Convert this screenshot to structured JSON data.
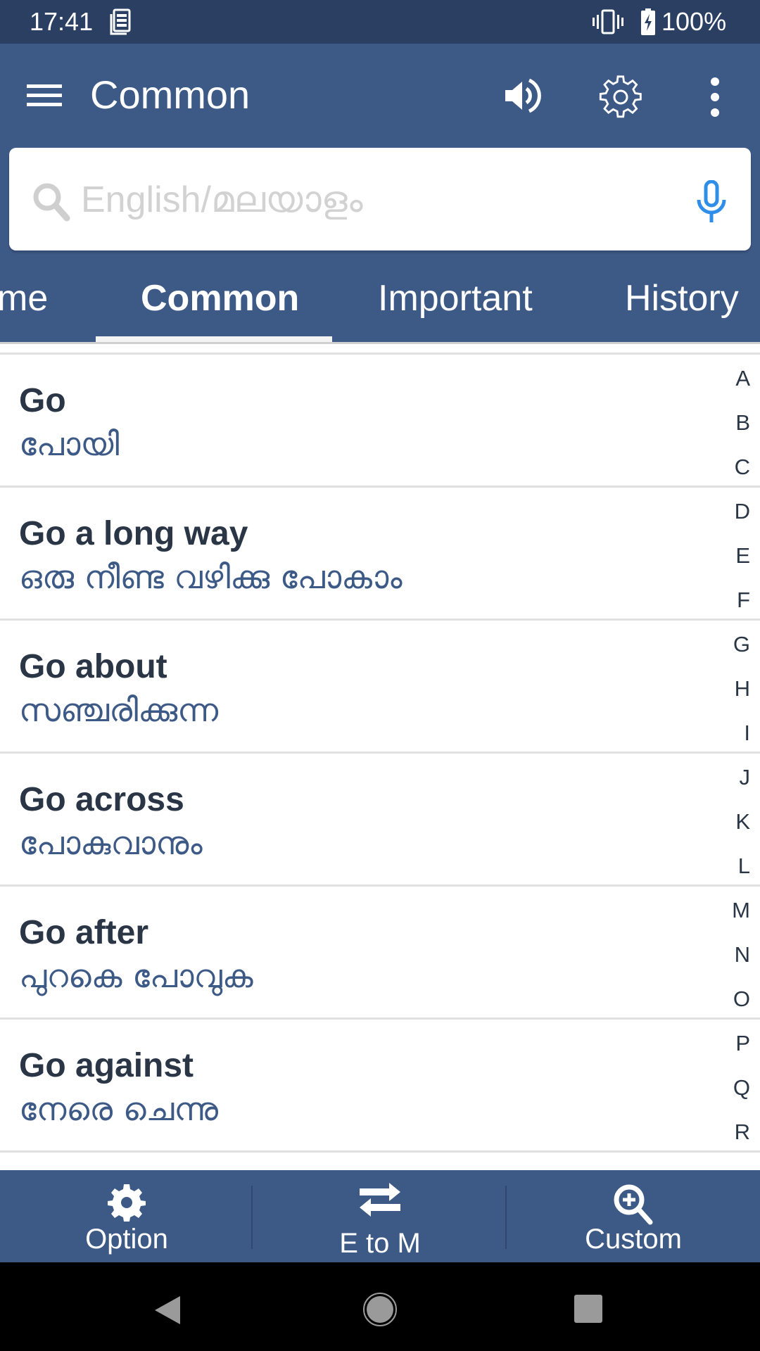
{
  "status_bar": {
    "time": "17:41",
    "battery": "100%",
    "icons": [
      "notification-icon",
      "vibrate-icon",
      "battery-charging-icon"
    ]
  },
  "app_bar": {
    "title": "Common",
    "icons": [
      "menu-icon",
      "speaker-icon",
      "settings-icon",
      "more-vert-icon"
    ]
  },
  "search": {
    "placeholder": "English/മലയാളം",
    "value": "",
    "icons": [
      "search-icon",
      "mic-icon"
    ]
  },
  "tabs": [
    {
      "label": "me",
      "active": false
    },
    {
      "label": "Common",
      "active": true
    },
    {
      "label": "Important",
      "active": false
    },
    {
      "label": "History",
      "active": false
    }
  ],
  "entries": [
    {
      "en": "Go",
      "ml": "പോയി"
    },
    {
      "en": "Go a long way",
      "ml": "ഒരു നീണ്ട വഴിക്കു പോകാം"
    },
    {
      "en": "Go about",
      "ml": "സഞ്ചരിക്കുന്ന"
    },
    {
      "en": "Go across",
      "ml": "പോകുവാനും"
    },
    {
      "en": "Go after",
      "ml": "പുറകെ പോവുക"
    },
    {
      "en": "Go against",
      "ml": "നേരെ ചെന്നു"
    }
  ],
  "alphabet": [
    "A",
    "B",
    "C",
    "D",
    "E",
    "F",
    "G",
    "H",
    "I",
    "J",
    "K",
    "L",
    "M",
    "N",
    "O",
    "P",
    "Q",
    "R"
  ],
  "bottom_bar": [
    {
      "label": "Option",
      "icon": "settings-icon"
    },
    {
      "label": "E to M",
      "icon": "swap-icon"
    },
    {
      "label": "Custom",
      "icon": "zoom-in-icon"
    }
  ],
  "colors": {
    "primary": "#3d5a87",
    "status_bar": "#2a3f62",
    "english_text": "#2a3646",
    "malayalam_text": "#3d5a87",
    "mic_accent": "#2f8fe8"
  }
}
